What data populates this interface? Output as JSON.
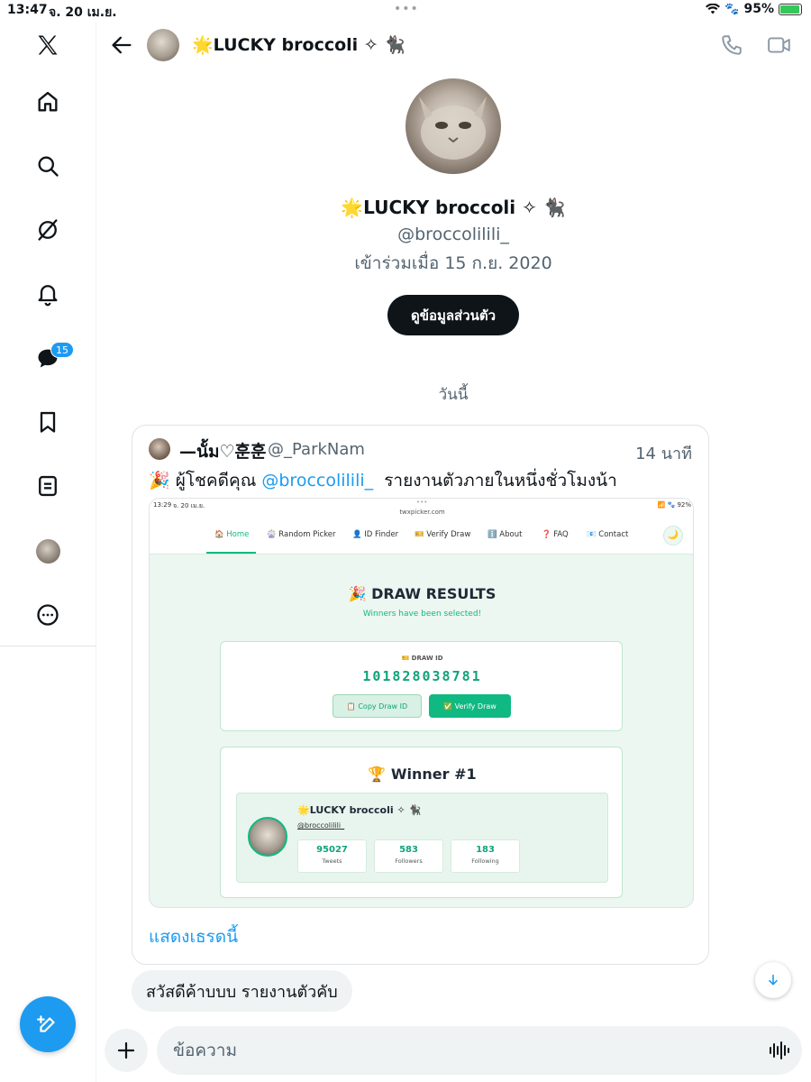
{
  "status_bar": {
    "time": "13:47",
    "date": "จ. 20 เม.ย.",
    "battery": "95%",
    "battery_fill": 0.95
  },
  "sidebar": {
    "messages_badge": "15",
    "icons": [
      "x-logo-icon",
      "home-icon",
      "search-icon",
      "grok-icon",
      "notifications-icon",
      "messages-icon",
      "bookmarks-icon",
      "lists-icon",
      "profile-avatar",
      "more-icon"
    ]
  },
  "header": {
    "name": "🌟LUCKY broccoli ✧ 🐈‍⬛"
  },
  "profile": {
    "name": "🌟LUCKY broccoli ✧ 🐈‍⬛",
    "handle": "@broccolilili_",
    "joined": "เข้าร่วมเมื่อ 15 ก.ย. 2020",
    "view_profile_label": "ดูข้อมูลส่วนตัว"
  },
  "day_label": "วันนี้",
  "post": {
    "name": "—นั้ม♡훈훈",
    "handle": "@_ParkNam",
    "time": "14 นาที",
    "text_prefix": "🎉 ผู้โชคดีคุณ ",
    "text_mention": "@broccolilili_",
    "text_suffix": "  รายงานตัวภายในหนึ่งชั่วโมงน้า",
    "show_thread": "แสดงเธรดนี้",
    "screenshot": {
      "time": "13:29",
      "date": "จ. 20 เม.ย.",
      "url": "twxpicker.com",
      "battery": "92%",
      "nav": [
        "🏠 Home",
        "🎡 Random Picker",
        "👤 ID Finder",
        "🎫 Verify Draw",
        "ℹ️ About",
        "❓ FAQ",
        "📧 Contact"
      ],
      "theme_icon": "🌙",
      "title": "🎉 DRAW RESULTS",
      "subtitle": "Winners have been selected!",
      "draw_id_label": "🎫 DRAW ID",
      "draw_id": "101828038781",
      "copy_label": "📋 Copy Draw ID",
      "verify_label": "✅ Verify Draw",
      "winner_title": "🏆 Winner #1",
      "winner_name": "🌟LUCKY broccoli ✧ 🐈‍⬛",
      "winner_handle": "@broccolilili_",
      "stats": [
        {
          "value": "95027",
          "label": "Tweets"
        },
        {
          "value": "583",
          "label": "Followers"
        },
        {
          "value": "183",
          "label": "Following"
        }
      ]
    }
  },
  "message": {
    "text": "สวัสดีค้าบบบ รายงานตัวคับ"
  },
  "composer": {
    "placeholder": "ข้อความ"
  },
  "colors": {
    "accent": "#1d9bf0",
    "text": "#0f1419",
    "muted": "#536471",
    "green": "#10b981"
  }
}
